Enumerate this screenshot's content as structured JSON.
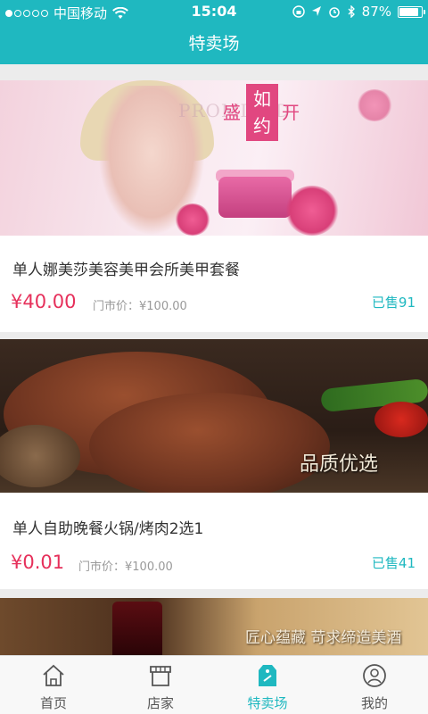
{
  "status_bar": {
    "carrier": "中国移动",
    "time": "15:04",
    "battery_text": "87%",
    "battery_level": 0.87,
    "signal_bars_filled": 1
  },
  "nav": {
    "title": "特卖场"
  },
  "deals": [
    {
      "title": "单人娜美莎美容美甲会所美甲套餐",
      "price": "¥40.00",
      "market_price": "门市价：¥100.00",
      "sold": "已售91",
      "image_text_badge": "如约",
      "image_text_left": "盛",
      "image_text_right": "开",
      "image_text_bg": "PROMISED"
    },
    {
      "title": "单人自助晚餐火锅/烤肉2选1",
      "price": "¥0.01",
      "market_price": "门市价：¥100.00",
      "sold": "已售41",
      "image_caption": "品质优选"
    },
    {
      "image_caption": "匠心蕴藏  苛求缔造美酒"
    }
  ],
  "tabs": [
    {
      "label": "首页",
      "icon": "home-icon",
      "active": false
    },
    {
      "label": "店家",
      "icon": "store-icon",
      "active": false
    },
    {
      "label": "特卖场",
      "icon": "tag-icon",
      "active": true
    },
    {
      "label": "我的",
      "icon": "user-icon",
      "active": false
    }
  ],
  "colors": {
    "accent": "#1fb8c0",
    "price": "#e6305b"
  }
}
